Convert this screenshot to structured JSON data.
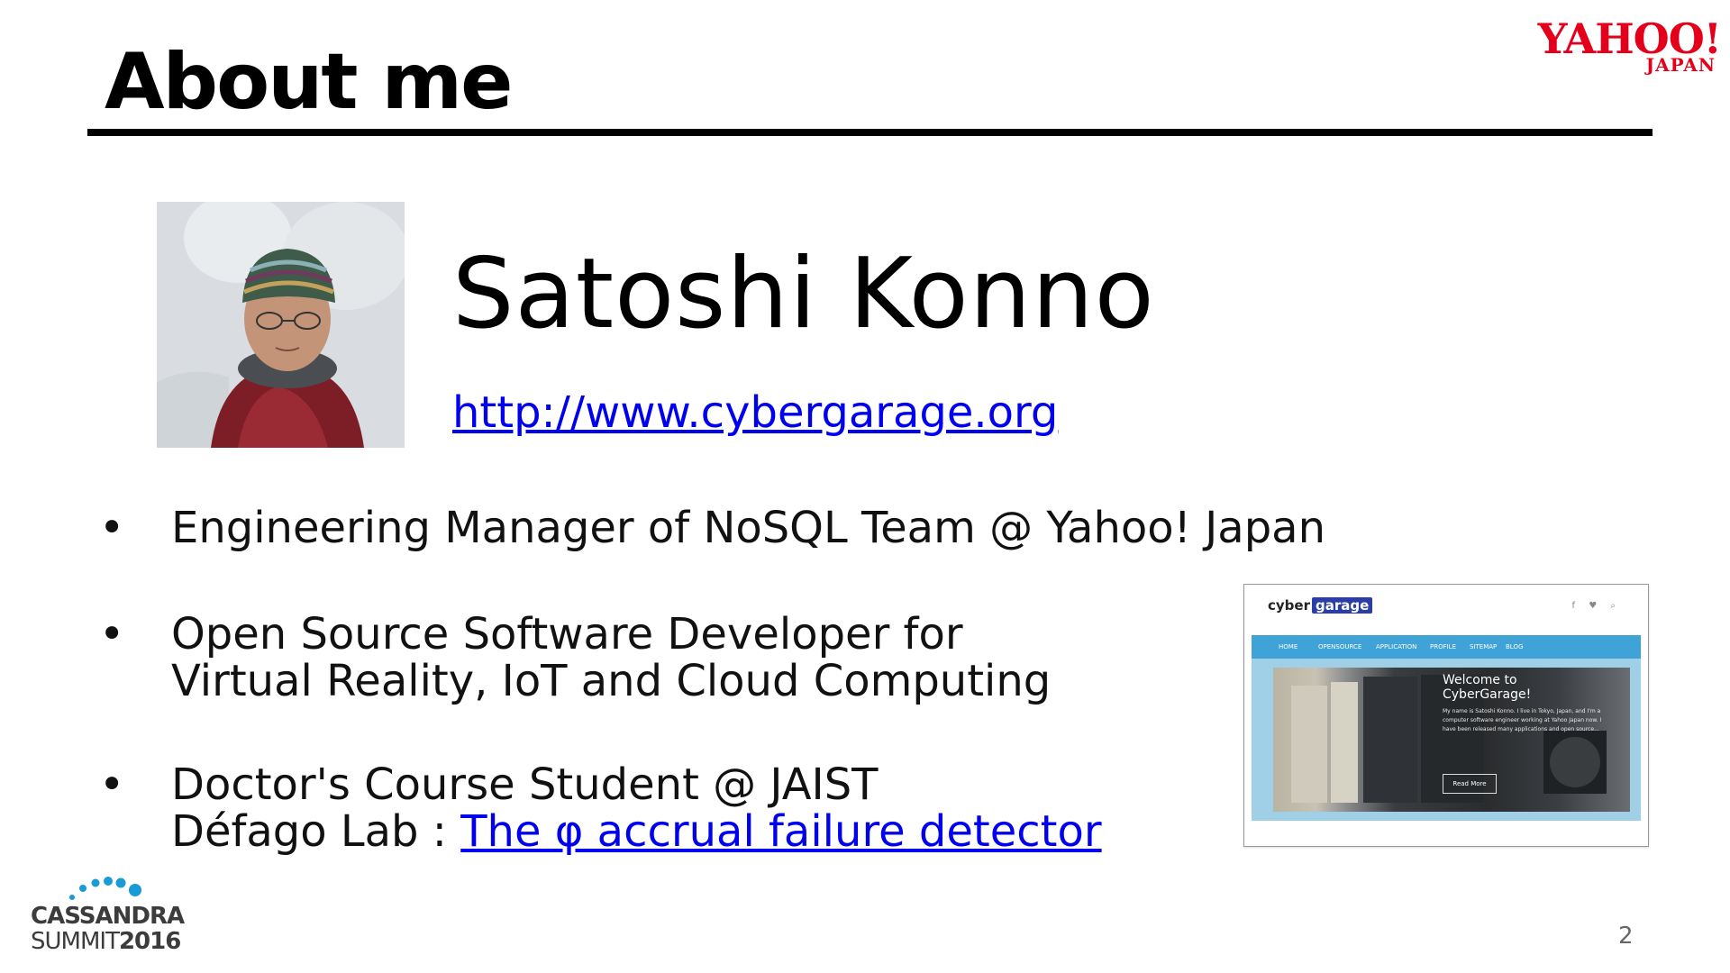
{
  "slide": {
    "title": "About me",
    "page_number": "2"
  },
  "brand": {
    "yahoo_main": "YAHOO!",
    "yahoo_sub": "JAPAN",
    "event_line1": "CASSANDRA",
    "event_line2_prefix": "SUMMIT",
    "event_line2_year": "2016"
  },
  "profile": {
    "name": "Satoshi Konno",
    "url": "http://www.cybergarage.org"
  },
  "bullets": [
    {
      "lines": [
        "Engineering Manager of NoSQL Team @ Yahoo! Japan"
      ]
    },
    {
      "lines": [
        "Open Source Software Developer for",
        "Virtual Reality, IoT and Cloud Computing"
      ]
    },
    {
      "lines": [
        "Doctor's Course Student @ JAIST"
      ],
      "prefix": "Défago Lab : ",
      "link": "The φ accrual failure detector"
    }
  ],
  "bullet_glyph": "•",
  "website_screenshot": {
    "logo_text": "cyber",
    "logo_box": "garage",
    "social": "f ♥ ⌕",
    "nav": [
      "HOME",
      "OPENSOURCE",
      "APPLICATION",
      "PROFILE",
      "SITEMAP",
      "BLOG"
    ],
    "hero_title": "Welcome to CyberGarage!",
    "hero_body": "My name is Satoshi Konno. I live in Tokyo, Japan, and I'm a computer software engineer working at Yahoo Japan now. I have been released many applications and open source...",
    "hero_button": "Read More"
  },
  "colors": {
    "yahoo_red": "#e4001b",
    "link_blue": "#0000ee",
    "nav_blue": "#3fa3d8",
    "cassandra_blue": "#1a9ad6"
  }
}
